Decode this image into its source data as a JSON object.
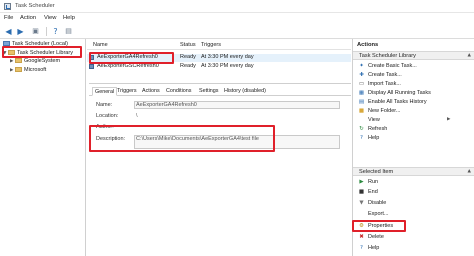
{
  "window": {
    "title": "Task Scheduler"
  },
  "menu": [
    "File",
    "Action",
    "View",
    "Help"
  ],
  "tree": {
    "root": "Task Scheduler (Local)",
    "library": "Task Scheduler Library",
    "children": [
      "GoogleSystem",
      "Microsoft"
    ]
  },
  "task_list": {
    "columns": [
      "Name",
      "Status",
      "Triggers"
    ],
    "rows": [
      {
        "name": "AeExporterGA4Refresh0",
        "status": "Ready",
        "triggers": "At 3:30 PM every day"
      },
      {
        "name": "AeExporterGSCRefresh0",
        "status": "Ready",
        "triggers": "At 3:30 PM every day"
      }
    ]
  },
  "details": {
    "tabs": [
      "General",
      "Triggers",
      "Actions",
      "Conditions",
      "Settings",
      "History (disabled)"
    ],
    "name_label": "Name:",
    "name_value": "AeExporterGA4Refresh0",
    "location_label": "Location:",
    "location_value": "\\",
    "author_label": "Author:",
    "author_value": "",
    "description_label": "Description:",
    "description_value": "C:\\Users\\Mike\\Documents\\AeExporterGA4\\test file"
  },
  "actions": {
    "title": "Actions",
    "library_section": "Task Scheduler Library",
    "library_items": [
      {
        "icon": "create-basic-task-icon",
        "label": "Create Basic Task..."
      },
      {
        "icon": "create-task-icon",
        "label": "Create Task..."
      },
      {
        "icon": "import-task-icon",
        "label": "Import Task..."
      },
      {
        "icon": "running-tasks-icon",
        "label": "Display All Running Tasks"
      },
      {
        "icon": "history-icon",
        "label": "Enable All Tasks History"
      },
      {
        "icon": "new-folder-icon",
        "label": "New Folder..."
      },
      {
        "icon": "view-icon",
        "label": "View"
      },
      {
        "icon": "refresh-icon",
        "label": "Refresh"
      },
      {
        "icon": "help-icon",
        "label": "Help"
      }
    ],
    "selected_section": "Selected Item",
    "selected_items": [
      {
        "icon": "run-icon",
        "label": "Run"
      },
      {
        "icon": "end-icon",
        "label": "End"
      },
      {
        "icon": "disable-icon",
        "label": "Disable"
      },
      {
        "icon": "export-icon",
        "label": "Export..."
      },
      {
        "icon": "properties-icon",
        "label": "Properties"
      },
      {
        "icon": "delete-icon",
        "label": "Delete"
      },
      {
        "icon": "help-icon",
        "label": "Help"
      }
    ]
  },
  "colors": {
    "highlight": "#e0202a",
    "accent": "#2b6cb0",
    "selected_row": "#e5f1fb"
  }
}
